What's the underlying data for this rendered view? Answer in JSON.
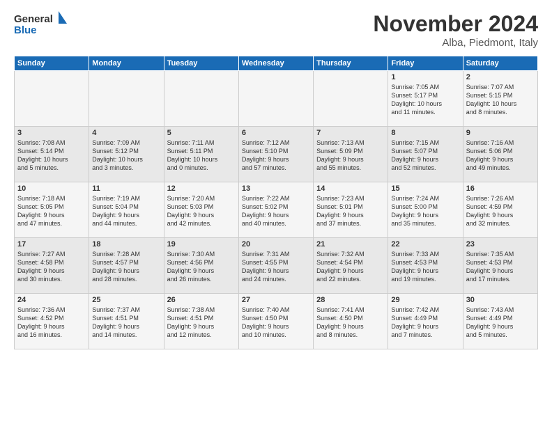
{
  "logo": {
    "line1": "General",
    "line2": "Blue"
  },
  "title": "November 2024",
  "location": "Alba, Piedmont, Italy",
  "weekdays": [
    "Sunday",
    "Monday",
    "Tuesday",
    "Wednesday",
    "Thursday",
    "Friday",
    "Saturday"
  ],
  "weeks": [
    [
      {
        "day": "",
        "info": ""
      },
      {
        "day": "",
        "info": ""
      },
      {
        "day": "",
        "info": ""
      },
      {
        "day": "",
        "info": ""
      },
      {
        "day": "",
        "info": ""
      },
      {
        "day": "1",
        "info": "Sunrise: 7:05 AM\nSunset: 5:17 PM\nDaylight: 10 hours\nand 11 minutes."
      },
      {
        "day": "2",
        "info": "Sunrise: 7:07 AM\nSunset: 5:15 PM\nDaylight: 10 hours\nand 8 minutes."
      }
    ],
    [
      {
        "day": "3",
        "info": "Sunrise: 7:08 AM\nSunset: 5:14 PM\nDaylight: 10 hours\nand 5 minutes."
      },
      {
        "day": "4",
        "info": "Sunrise: 7:09 AM\nSunset: 5:12 PM\nDaylight: 10 hours\nand 3 minutes."
      },
      {
        "day": "5",
        "info": "Sunrise: 7:11 AM\nSunset: 5:11 PM\nDaylight: 10 hours\nand 0 minutes."
      },
      {
        "day": "6",
        "info": "Sunrise: 7:12 AM\nSunset: 5:10 PM\nDaylight: 9 hours\nand 57 minutes."
      },
      {
        "day": "7",
        "info": "Sunrise: 7:13 AM\nSunset: 5:09 PM\nDaylight: 9 hours\nand 55 minutes."
      },
      {
        "day": "8",
        "info": "Sunrise: 7:15 AM\nSunset: 5:07 PM\nDaylight: 9 hours\nand 52 minutes."
      },
      {
        "day": "9",
        "info": "Sunrise: 7:16 AM\nSunset: 5:06 PM\nDaylight: 9 hours\nand 49 minutes."
      }
    ],
    [
      {
        "day": "10",
        "info": "Sunrise: 7:18 AM\nSunset: 5:05 PM\nDaylight: 9 hours\nand 47 minutes."
      },
      {
        "day": "11",
        "info": "Sunrise: 7:19 AM\nSunset: 5:04 PM\nDaylight: 9 hours\nand 44 minutes."
      },
      {
        "day": "12",
        "info": "Sunrise: 7:20 AM\nSunset: 5:03 PM\nDaylight: 9 hours\nand 42 minutes."
      },
      {
        "day": "13",
        "info": "Sunrise: 7:22 AM\nSunset: 5:02 PM\nDaylight: 9 hours\nand 40 minutes."
      },
      {
        "day": "14",
        "info": "Sunrise: 7:23 AM\nSunset: 5:01 PM\nDaylight: 9 hours\nand 37 minutes."
      },
      {
        "day": "15",
        "info": "Sunrise: 7:24 AM\nSunset: 5:00 PM\nDaylight: 9 hours\nand 35 minutes."
      },
      {
        "day": "16",
        "info": "Sunrise: 7:26 AM\nSunset: 4:59 PM\nDaylight: 9 hours\nand 32 minutes."
      }
    ],
    [
      {
        "day": "17",
        "info": "Sunrise: 7:27 AM\nSunset: 4:58 PM\nDaylight: 9 hours\nand 30 minutes."
      },
      {
        "day": "18",
        "info": "Sunrise: 7:28 AM\nSunset: 4:57 PM\nDaylight: 9 hours\nand 28 minutes."
      },
      {
        "day": "19",
        "info": "Sunrise: 7:30 AM\nSunset: 4:56 PM\nDaylight: 9 hours\nand 26 minutes."
      },
      {
        "day": "20",
        "info": "Sunrise: 7:31 AM\nSunset: 4:55 PM\nDaylight: 9 hours\nand 24 minutes."
      },
      {
        "day": "21",
        "info": "Sunrise: 7:32 AM\nSunset: 4:54 PM\nDaylight: 9 hours\nand 22 minutes."
      },
      {
        "day": "22",
        "info": "Sunrise: 7:33 AM\nSunset: 4:53 PM\nDaylight: 9 hours\nand 19 minutes."
      },
      {
        "day": "23",
        "info": "Sunrise: 7:35 AM\nSunset: 4:53 PM\nDaylight: 9 hours\nand 17 minutes."
      }
    ],
    [
      {
        "day": "24",
        "info": "Sunrise: 7:36 AM\nSunset: 4:52 PM\nDaylight: 9 hours\nand 16 minutes."
      },
      {
        "day": "25",
        "info": "Sunrise: 7:37 AM\nSunset: 4:51 PM\nDaylight: 9 hours\nand 14 minutes."
      },
      {
        "day": "26",
        "info": "Sunrise: 7:38 AM\nSunset: 4:51 PM\nDaylight: 9 hours\nand 12 minutes."
      },
      {
        "day": "27",
        "info": "Sunrise: 7:40 AM\nSunset: 4:50 PM\nDaylight: 9 hours\nand 10 minutes."
      },
      {
        "day": "28",
        "info": "Sunrise: 7:41 AM\nSunset: 4:50 PM\nDaylight: 9 hours\nand 8 minutes."
      },
      {
        "day": "29",
        "info": "Sunrise: 7:42 AM\nSunset: 4:49 PM\nDaylight: 9 hours\nand 7 minutes."
      },
      {
        "day": "30",
        "info": "Sunrise: 7:43 AM\nSunset: 4:49 PM\nDaylight: 9 hours\nand 5 minutes."
      }
    ]
  ]
}
